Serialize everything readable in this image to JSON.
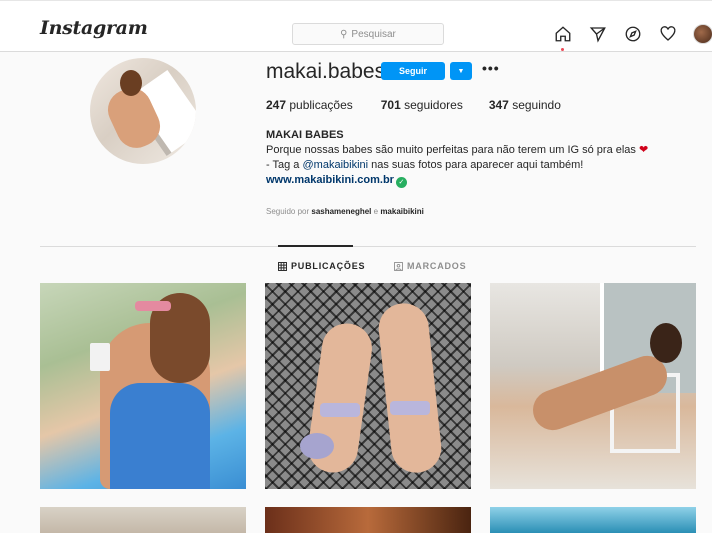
{
  "header": {
    "logo": "Instagram",
    "search_placeholder": "Pesquisar",
    "nav_icons": [
      "home-icon",
      "direct-icon",
      "explore-icon",
      "activity-heart-icon",
      "profile-avatar"
    ]
  },
  "profile": {
    "username": "makai.babes",
    "follow_label": "Seguir",
    "more_label": "•••",
    "stats": {
      "posts_count": "247",
      "posts_label": " publicações",
      "followers_count": "701",
      "followers_label": " seguidores",
      "following_count": "347",
      "following_label": " seguindo"
    },
    "bio": {
      "name": "MAKAI BABES",
      "line1": "Porque nossas babes são muito perfeitas para não terem um IG só pra elas",
      "line1_emoji": "❤",
      "line2_prefix": "- Tag a ",
      "line2_mention": "@makaibikini",
      "line2_suffix": " nas suas fotos para aparecer aqui também!",
      "website": "www.makaibikini.com.br"
    },
    "followed_by": {
      "prefix": "Seguido por ",
      "user1": "sashameneghel",
      "joiner": " e ",
      "user2": "makaibikini"
    }
  },
  "tabs": {
    "posts": "PUBLICAÇÕES",
    "tagged": "MARCADOS"
  },
  "colors": {
    "accent": "#0095f6",
    "link": "#00376b",
    "notification_dot": "#ed4956",
    "verified": "#27ae60"
  }
}
